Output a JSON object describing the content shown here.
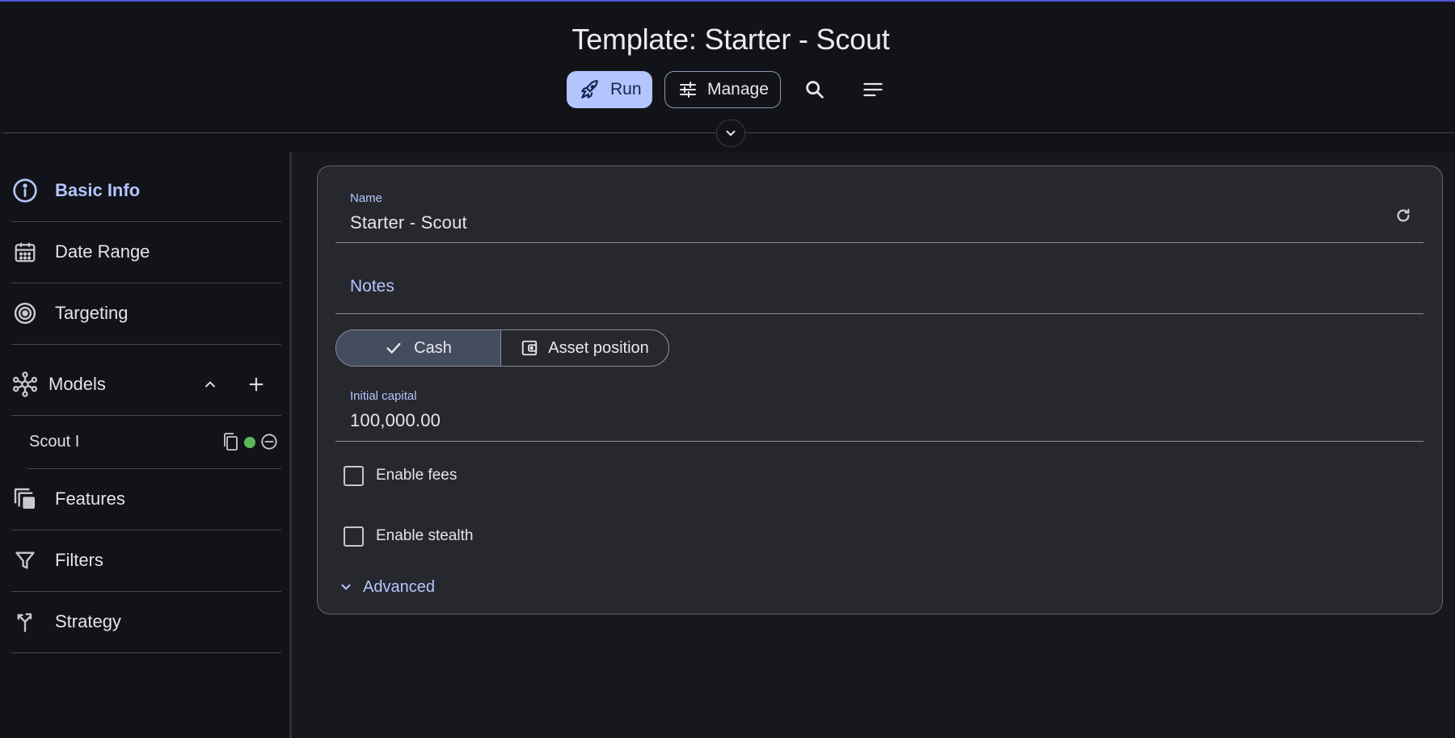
{
  "header": {
    "title": "Template: Starter - Scout",
    "run_label": "Run",
    "manage_label": "Manage",
    "search_icon": "search-icon",
    "menu_icon": "sort-menu-icon"
  },
  "sidebar": {
    "items": [
      {
        "label": "Basic Info",
        "icon": "info-icon",
        "active": true
      },
      {
        "label": "Date Range",
        "icon": "calendar-icon"
      },
      {
        "label": "Targeting",
        "icon": "target-icon"
      },
      {
        "label": "Models",
        "icon": "hub-icon"
      },
      {
        "label": "Features",
        "icon": "layers-icon"
      },
      {
        "label": "Filters",
        "icon": "filter-icon"
      },
      {
        "label": "Strategy",
        "icon": "merge-icon"
      }
    ],
    "models_children": [
      {
        "label": "Scout I",
        "status_color": "#5cb85c"
      }
    ]
  },
  "form": {
    "name_label": "Name",
    "name_value": "Starter - Scout",
    "notes_placeholder": "Notes",
    "segment": {
      "options": [
        "Cash",
        "Asset position"
      ],
      "selected": "Cash"
    },
    "capital_label": "Initial capital",
    "capital_value": "100,000.00",
    "enable_fees_label": "Enable fees",
    "enable_stealth_label": "Enable stealth",
    "advanced_label": "Advanced"
  },
  "colors": {
    "accent": "#b4c5ff",
    "background": "#111318",
    "card": "#26282e",
    "status_green": "#5cb85c"
  }
}
